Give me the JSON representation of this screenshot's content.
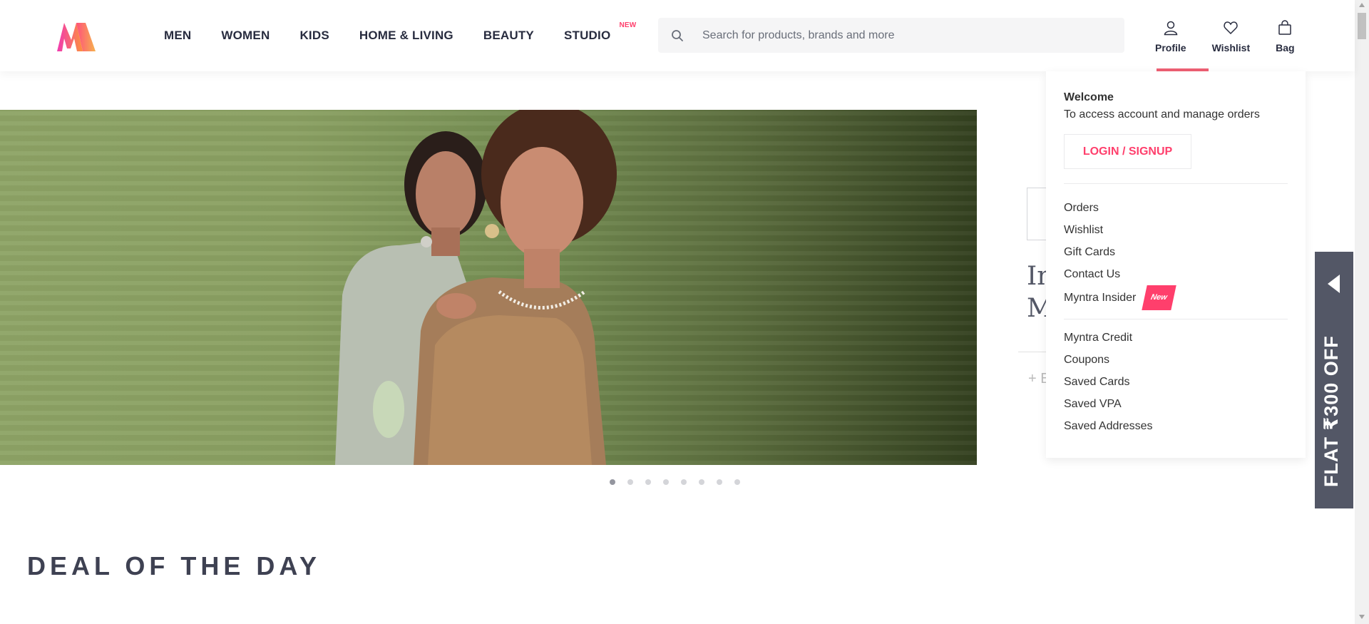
{
  "header": {
    "nav": [
      {
        "label": "MEN"
      },
      {
        "label": "WOMEN"
      },
      {
        "label": "KIDS"
      },
      {
        "label": "HOME & LIVING"
      },
      {
        "label": "BEAUTY"
      },
      {
        "label": "STUDIO",
        "badge": "NEW"
      }
    ],
    "search": {
      "placeholder": "Search for products, brands and more"
    },
    "actions": {
      "profile": "Profile",
      "wishlist": "Wishlist",
      "bag": "Bag"
    }
  },
  "profile_menu": {
    "welcome": "Welcome",
    "subtitle": "To access account and manage orders",
    "login_label": "LOGIN / SIGNUP",
    "group1": [
      "Orders",
      "Wishlist",
      "Gift Cards",
      "Contact Us"
    ],
    "insider": {
      "label": "Myntra Insider",
      "badge": "New"
    },
    "group2": [
      "Myntra Credit",
      "Coupons",
      "Saved Cards",
      "Saved VPA",
      "Saved Addresses"
    ]
  },
  "side_promo": {
    "line1": "In",
    "line2": "M",
    "more": "+ E"
  },
  "carousel": {
    "slides": 8,
    "active_index": 0
  },
  "deal_title": "DEAL OF THE DAY",
  "flat_offer": "FLAT ₹300 OFF",
  "colors": {
    "brand_pink": "#ff3f6c",
    "tab_bg": "#535766",
    "accent_underline": "#ee5f73"
  }
}
